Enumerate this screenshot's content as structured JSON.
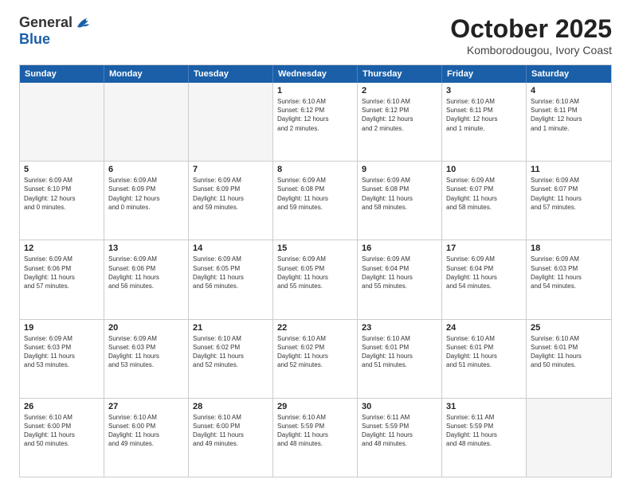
{
  "logo": {
    "general": "General",
    "blue": "Blue"
  },
  "title": "October 2025",
  "subtitle": "Komborodougou, Ivory Coast",
  "header_days": [
    "Sunday",
    "Monday",
    "Tuesday",
    "Wednesday",
    "Thursday",
    "Friday",
    "Saturday"
  ],
  "weeks": [
    [
      {
        "day": "",
        "info": "",
        "empty": true
      },
      {
        "day": "",
        "info": "",
        "empty": true
      },
      {
        "day": "",
        "info": "",
        "empty": true
      },
      {
        "day": "1",
        "info": "Sunrise: 6:10 AM\nSunset: 6:12 PM\nDaylight: 12 hours\nand 2 minutes."
      },
      {
        "day": "2",
        "info": "Sunrise: 6:10 AM\nSunset: 6:12 PM\nDaylight: 12 hours\nand 2 minutes."
      },
      {
        "day": "3",
        "info": "Sunrise: 6:10 AM\nSunset: 6:11 PM\nDaylight: 12 hours\nand 1 minute."
      },
      {
        "day": "4",
        "info": "Sunrise: 6:10 AM\nSunset: 6:11 PM\nDaylight: 12 hours\nand 1 minute."
      }
    ],
    [
      {
        "day": "5",
        "info": "Sunrise: 6:09 AM\nSunset: 6:10 PM\nDaylight: 12 hours\nand 0 minutes."
      },
      {
        "day": "6",
        "info": "Sunrise: 6:09 AM\nSunset: 6:09 PM\nDaylight: 12 hours\nand 0 minutes."
      },
      {
        "day": "7",
        "info": "Sunrise: 6:09 AM\nSunset: 6:09 PM\nDaylight: 11 hours\nand 59 minutes."
      },
      {
        "day": "8",
        "info": "Sunrise: 6:09 AM\nSunset: 6:08 PM\nDaylight: 11 hours\nand 59 minutes."
      },
      {
        "day": "9",
        "info": "Sunrise: 6:09 AM\nSunset: 6:08 PM\nDaylight: 11 hours\nand 58 minutes."
      },
      {
        "day": "10",
        "info": "Sunrise: 6:09 AM\nSunset: 6:07 PM\nDaylight: 11 hours\nand 58 minutes."
      },
      {
        "day": "11",
        "info": "Sunrise: 6:09 AM\nSunset: 6:07 PM\nDaylight: 11 hours\nand 57 minutes."
      }
    ],
    [
      {
        "day": "12",
        "info": "Sunrise: 6:09 AM\nSunset: 6:06 PM\nDaylight: 11 hours\nand 57 minutes."
      },
      {
        "day": "13",
        "info": "Sunrise: 6:09 AM\nSunset: 6:06 PM\nDaylight: 11 hours\nand 56 minutes."
      },
      {
        "day": "14",
        "info": "Sunrise: 6:09 AM\nSunset: 6:05 PM\nDaylight: 11 hours\nand 56 minutes."
      },
      {
        "day": "15",
        "info": "Sunrise: 6:09 AM\nSunset: 6:05 PM\nDaylight: 11 hours\nand 55 minutes."
      },
      {
        "day": "16",
        "info": "Sunrise: 6:09 AM\nSunset: 6:04 PM\nDaylight: 11 hours\nand 55 minutes."
      },
      {
        "day": "17",
        "info": "Sunrise: 6:09 AM\nSunset: 6:04 PM\nDaylight: 11 hours\nand 54 minutes."
      },
      {
        "day": "18",
        "info": "Sunrise: 6:09 AM\nSunset: 6:03 PM\nDaylight: 11 hours\nand 54 minutes."
      }
    ],
    [
      {
        "day": "19",
        "info": "Sunrise: 6:09 AM\nSunset: 6:03 PM\nDaylight: 11 hours\nand 53 minutes."
      },
      {
        "day": "20",
        "info": "Sunrise: 6:09 AM\nSunset: 6:03 PM\nDaylight: 11 hours\nand 53 minutes."
      },
      {
        "day": "21",
        "info": "Sunrise: 6:10 AM\nSunset: 6:02 PM\nDaylight: 11 hours\nand 52 minutes."
      },
      {
        "day": "22",
        "info": "Sunrise: 6:10 AM\nSunset: 6:02 PM\nDaylight: 11 hours\nand 52 minutes."
      },
      {
        "day": "23",
        "info": "Sunrise: 6:10 AM\nSunset: 6:01 PM\nDaylight: 11 hours\nand 51 minutes."
      },
      {
        "day": "24",
        "info": "Sunrise: 6:10 AM\nSunset: 6:01 PM\nDaylight: 11 hours\nand 51 minutes."
      },
      {
        "day": "25",
        "info": "Sunrise: 6:10 AM\nSunset: 6:01 PM\nDaylight: 11 hours\nand 50 minutes."
      }
    ],
    [
      {
        "day": "26",
        "info": "Sunrise: 6:10 AM\nSunset: 6:00 PM\nDaylight: 11 hours\nand 50 minutes."
      },
      {
        "day": "27",
        "info": "Sunrise: 6:10 AM\nSunset: 6:00 PM\nDaylight: 11 hours\nand 49 minutes."
      },
      {
        "day": "28",
        "info": "Sunrise: 6:10 AM\nSunset: 6:00 PM\nDaylight: 11 hours\nand 49 minutes."
      },
      {
        "day": "29",
        "info": "Sunrise: 6:10 AM\nSunset: 5:59 PM\nDaylight: 11 hours\nand 48 minutes."
      },
      {
        "day": "30",
        "info": "Sunrise: 6:11 AM\nSunset: 5:59 PM\nDaylight: 11 hours\nand 48 minutes."
      },
      {
        "day": "31",
        "info": "Sunrise: 6:11 AM\nSunset: 5:59 PM\nDaylight: 11 hours\nand 48 minutes."
      },
      {
        "day": "",
        "info": "",
        "empty": true
      }
    ]
  ]
}
